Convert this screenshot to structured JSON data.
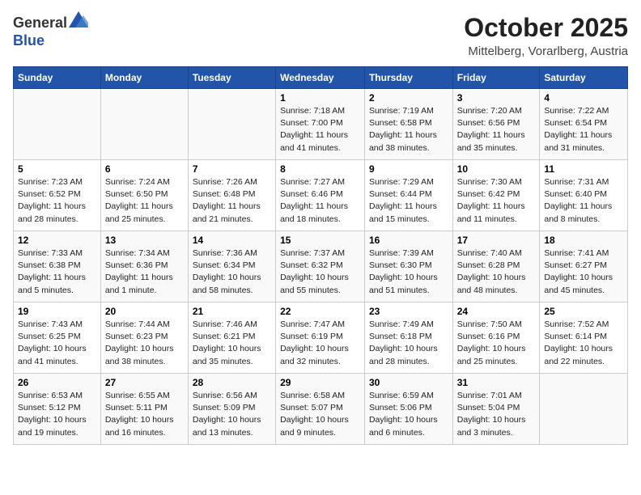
{
  "header": {
    "logo_line1": "General",
    "logo_line2": "Blue",
    "month": "October 2025",
    "location": "Mittelberg, Vorarlberg, Austria"
  },
  "weekdays": [
    "Sunday",
    "Monday",
    "Tuesday",
    "Wednesday",
    "Thursday",
    "Friday",
    "Saturday"
  ],
  "weeks": [
    [
      {
        "day": "",
        "info": ""
      },
      {
        "day": "",
        "info": ""
      },
      {
        "day": "",
        "info": ""
      },
      {
        "day": "1",
        "info": "Sunrise: 7:18 AM\nSunset: 7:00 PM\nDaylight: 11 hours and 41 minutes."
      },
      {
        "day": "2",
        "info": "Sunrise: 7:19 AM\nSunset: 6:58 PM\nDaylight: 11 hours and 38 minutes."
      },
      {
        "day": "3",
        "info": "Sunrise: 7:20 AM\nSunset: 6:56 PM\nDaylight: 11 hours and 35 minutes."
      },
      {
        "day": "4",
        "info": "Sunrise: 7:22 AM\nSunset: 6:54 PM\nDaylight: 11 hours and 31 minutes."
      }
    ],
    [
      {
        "day": "5",
        "info": "Sunrise: 7:23 AM\nSunset: 6:52 PM\nDaylight: 11 hours and 28 minutes."
      },
      {
        "day": "6",
        "info": "Sunrise: 7:24 AM\nSunset: 6:50 PM\nDaylight: 11 hours and 25 minutes."
      },
      {
        "day": "7",
        "info": "Sunrise: 7:26 AM\nSunset: 6:48 PM\nDaylight: 11 hours and 21 minutes."
      },
      {
        "day": "8",
        "info": "Sunrise: 7:27 AM\nSunset: 6:46 PM\nDaylight: 11 hours and 18 minutes."
      },
      {
        "day": "9",
        "info": "Sunrise: 7:29 AM\nSunset: 6:44 PM\nDaylight: 11 hours and 15 minutes."
      },
      {
        "day": "10",
        "info": "Sunrise: 7:30 AM\nSunset: 6:42 PM\nDaylight: 11 hours and 11 minutes."
      },
      {
        "day": "11",
        "info": "Sunrise: 7:31 AM\nSunset: 6:40 PM\nDaylight: 11 hours and 8 minutes."
      }
    ],
    [
      {
        "day": "12",
        "info": "Sunrise: 7:33 AM\nSunset: 6:38 PM\nDaylight: 11 hours and 5 minutes."
      },
      {
        "day": "13",
        "info": "Sunrise: 7:34 AM\nSunset: 6:36 PM\nDaylight: 11 hours and 1 minute."
      },
      {
        "day": "14",
        "info": "Sunrise: 7:36 AM\nSunset: 6:34 PM\nDaylight: 10 hours and 58 minutes."
      },
      {
        "day": "15",
        "info": "Sunrise: 7:37 AM\nSunset: 6:32 PM\nDaylight: 10 hours and 55 minutes."
      },
      {
        "day": "16",
        "info": "Sunrise: 7:39 AM\nSunset: 6:30 PM\nDaylight: 10 hours and 51 minutes."
      },
      {
        "day": "17",
        "info": "Sunrise: 7:40 AM\nSunset: 6:28 PM\nDaylight: 10 hours and 48 minutes."
      },
      {
        "day": "18",
        "info": "Sunrise: 7:41 AM\nSunset: 6:27 PM\nDaylight: 10 hours and 45 minutes."
      }
    ],
    [
      {
        "day": "19",
        "info": "Sunrise: 7:43 AM\nSunset: 6:25 PM\nDaylight: 10 hours and 41 minutes."
      },
      {
        "day": "20",
        "info": "Sunrise: 7:44 AM\nSunset: 6:23 PM\nDaylight: 10 hours and 38 minutes."
      },
      {
        "day": "21",
        "info": "Sunrise: 7:46 AM\nSunset: 6:21 PM\nDaylight: 10 hours and 35 minutes."
      },
      {
        "day": "22",
        "info": "Sunrise: 7:47 AM\nSunset: 6:19 PM\nDaylight: 10 hours and 32 minutes."
      },
      {
        "day": "23",
        "info": "Sunrise: 7:49 AM\nSunset: 6:18 PM\nDaylight: 10 hours and 28 minutes."
      },
      {
        "day": "24",
        "info": "Sunrise: 7:50 AM\nSunset: 6:16 PM\nDaylight: 10 hours and 25 minutes."
      },
      {
        "day": "25",
        "info": "Sunrise: 7:52 AM\nSunset: 6:14 PM\nDaylight: 10 hours and 22 minutes."
      }
    ],
    [
      {
        "day": "26",
        "info": "Sunrise: 6:53 AM\nSunset: 5:12 PM\nDaylight: 10 hours and 19 minutes."
      },
      {
        "day": "27",
        "info": "Sunrise: 6:55 AM\nSunset: 5:11 PM\nDaylight: 10 hours and 16 minutes."
      },
      {
        "day": "28",
        "info": "Sunrise: 6:56 AM\nSunset: 5:09 PM\nDaylight: 10 hours and 13 minutes."
      },
      {
        "day": "29",
        "info": "Sunrise: 6:58 AM\nSunset: 5:07 PM\nDaylight: 10 hours and 9 minutes."
      },
      {
        "day": "30",
        "info": "Sunrise: 6:59 AM\nSunset: 5:06 PM\nDaylight: 10 hours and 6 minutes."
      },
      {
        "day": "31",
        "info": "Sunrise: 7:01 AM\nSunset: 5:04 PM\nDaylight: 10 hours and 3 minutes."
      },
      {
        "day": "",
        "info": ""
      }
    ]
  ]
}
